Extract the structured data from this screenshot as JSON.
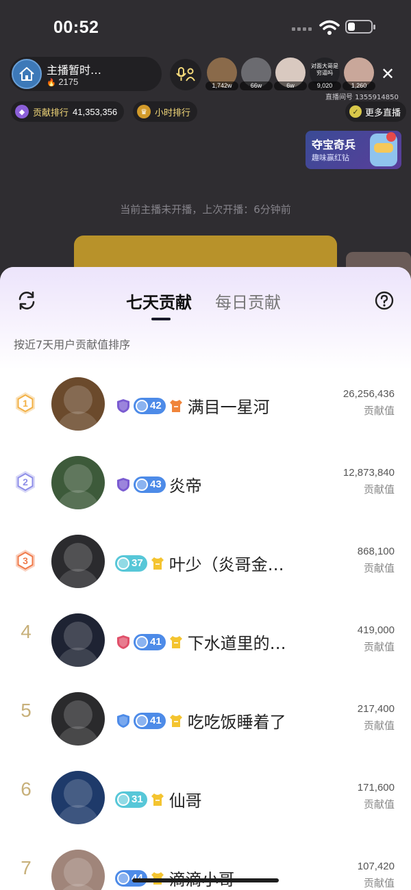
{
  "status": {
    "time": "00:52"
  },
  "host": {
    "name": "主播暂时…",
    "fans": "2175"
  },
  "viewers": [
    {
      "count": "1,742w",
      "color": "#8a6a4a"
    },
    {
      "count": "66w",
      "color": "#6b6b70"
    },
    {
      "count": "6w",
      "color": "#d9c9c0"
    },
    {
      "count": "9,020",
      "color": "#222226",
      "caption": "对面大哥是穷逼吗"
    },
    {
      "count": "1,260",
      "color": "#c9a79a"
    }
  ],
  "room": {
    "id_text": "直播间号 1355914850"
  },
  "pills": {
    "contribution_label": "贡献排行",
    "contribution_value": "41,353,356",
    "hourly_label": "小时排行",
    "more_live": "更多直播"
  },
  "promo": {
    "title": "夺宝奇兵",
    "subtitle": "趣味赢红钻"
  },
  "offline_note": "当前主播未开播，上次开播：6分钟前",
  "panel": {
    "tabs": [
      "七天贡献",
      "每日贡献"
    ],
    "active_tab": "七天贡献",
    "subtitle": "按近7天用户贡献值排序",
    "score_label": "贡献值"
  },
  "ranking": [
    {
      "rank": "1",
      "name": "满目一星河",
      "level": "42",
      "score": "26,256,436",
      "level_color": "#4d8be8",
      "avatar_color": "#6b4a2c",
      "has_guard": true,
      "guard_color": "#7a5bd1",
      "shirt_color": "#f0843a"
    },
    {
      "rank": "2",
      "name": "炎帝",
      "level": "43",
      "score": "12,873,840",
      "level_color": "#4d8be8",
      "avatar_color": "#3d5a3a",
      "has_guard": true,
      "guard_color": "#7a5bd1",
      "shirt_color": ""
    },
    {
      "rank": "3",
      "name": "叶少（炎哥金…",
      "level": "37",
      "score": "868,100",
      "level_color": "#57c7d8",
      "avatar_color": "#2b2b2e",
      "has_guard": false,
      "guard_color": "",
      "shirt_color": "#f4c430"
    },
    {
      "rank": "4",
      "name": "下水道里的…",
      "level": "41",
      "score": "419,000",
      "level_color": "#4d8be8",
      "avatar_color": "#1e2333",
      "has_guard": true,
      "guard_color": "#e0506a",
      "shirt_color": "#f4c430"
    },
    {
      "rank": "5",
      "name": "吃吃饭睡着了",
      "level": "41",
      "score": "217,400",
      "level_color": "#4d8be8",
      "avatar_color": "#2a2a2c",
      "has_guard": true,
      "guard_color": "#4d8be8",
      "shirt_color": "#f4c430"
    },
    {
      "rank": "6",
      "name": "仙哥",
      "level": "31",
      "score": "171,600",
      "level_color": "#57c7d8",
      "avatar_color": "#1e3a6a",
      "has_guard": false,
      "guard_color": "",
      "shirt_color": "#f4c430"
    },
    {
      "rank": "7",
      "name": "滴滴小哥",
      "level": "44",
      "score": "107,420",
      "level_color": "#4d8be8",
      "avatar_color": "#a0857a",
      "has_guard": false,
      "guard_color": "",
      "shirt_color": "#f4c430"
    }
  ],
  "medal_colors": {
    "1": "#f2b045",
    "2": "#8e8ee8",
    "3": "#f07a4a"
  }
}
